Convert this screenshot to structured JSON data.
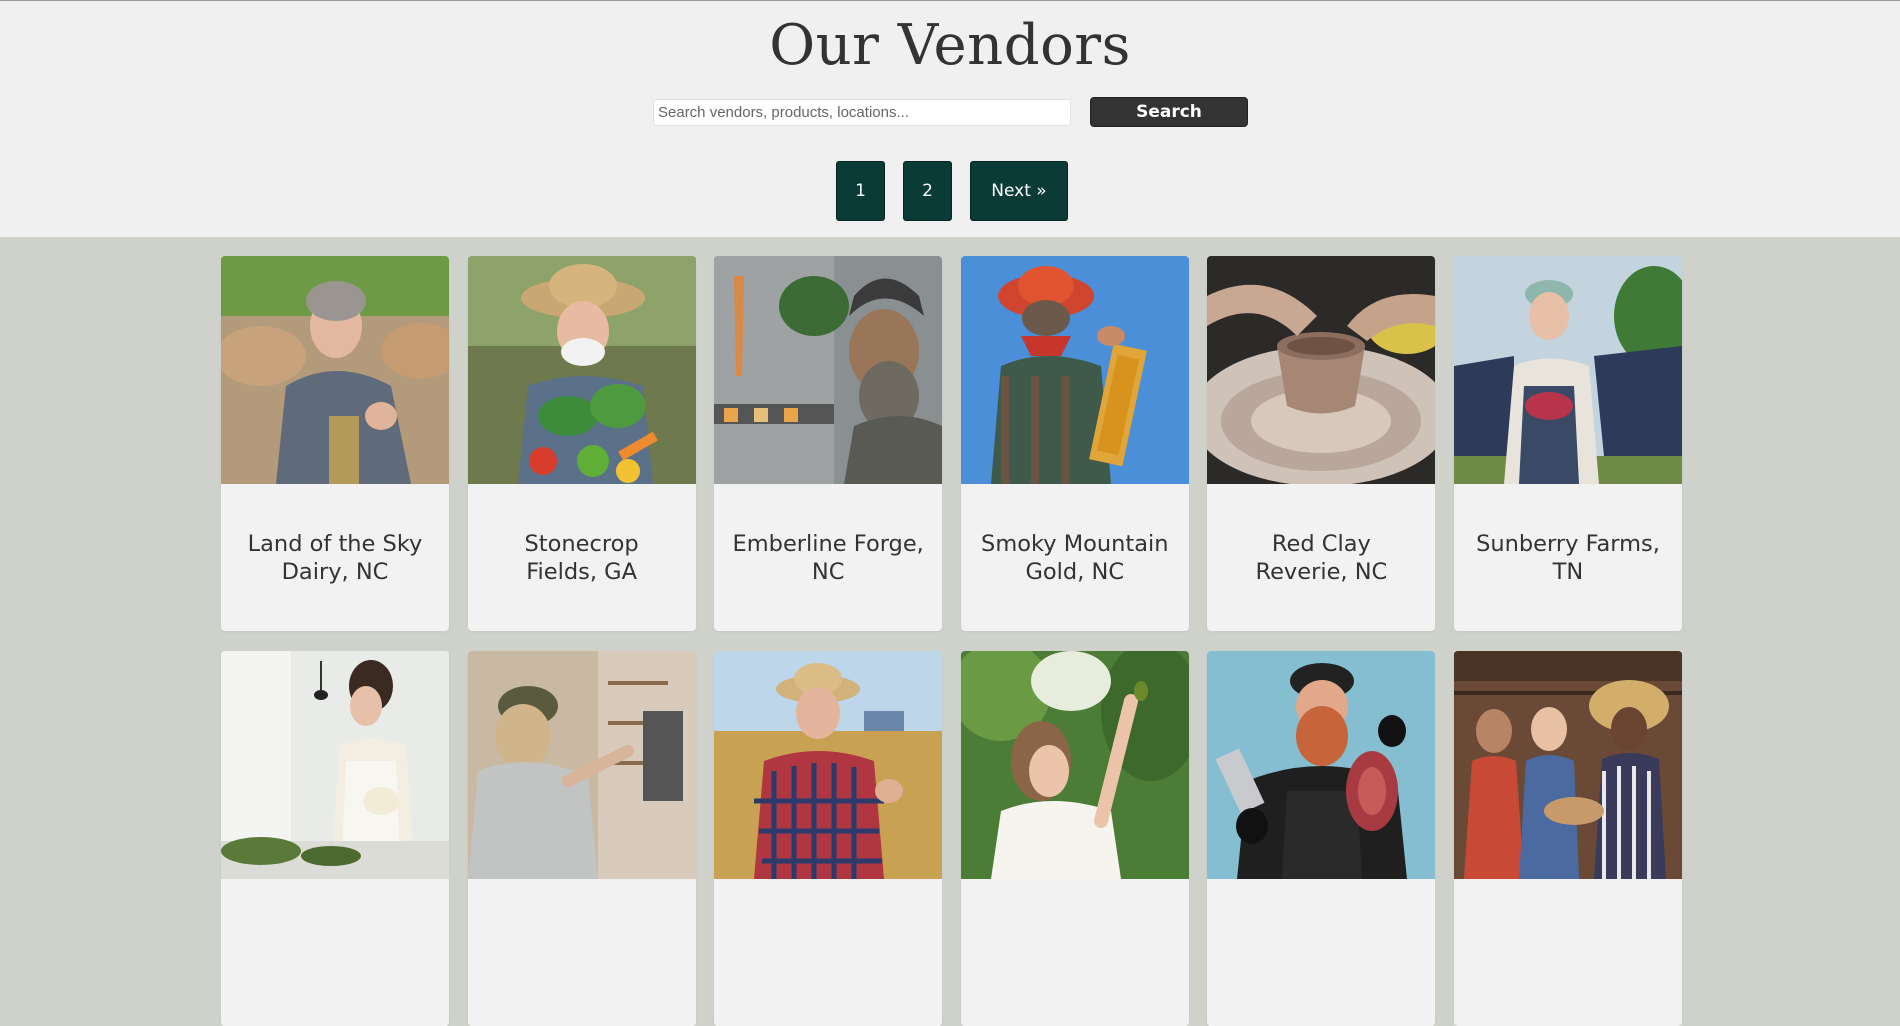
{
  "page": {
    "title": "Our Vendors"
  },
  "search": {
    "placeholder": "Search vendors, products, locations...",
    "value": "",
    "button_label": "Search"
  },
  "pagination": {
    "pages": [
      "1",
      "2"
    ],
    "next_label": "Next »"
  },
  "colors": {
    "header_bg": "#f0f0f0",
    "body_bg": "#cfd1cb",
    "pagination_bg": "#0b3b36",
    "search_button_bg": "#333333"
  },
  "vendors": [
    {
      "name": "Land of the Sky Dairy, NC",
      "photo": "dairy-farmer-photo"
    },
    {
      "name": "Stonecrop Fields, GA",
      "photo": "vegetable-farmer-photo"
    },
    {
      "name": "Emberline Forge, NC",
      "photo": "blacksmith-photo"
    },
    {
      "name": "Smoky Mountain Gold, NC",
      "photo": "beekeeper-photo"
    },
    {
      "name": "Red Clay Reverie, NC",
      "photo": "pottery-wheel-photo"
    },
    {
      "name": "Sunberry Farms, TN",
      "photo": "berry-farmer-photo"
    },
    {
      "name": "",
      "photo": "florist-photo"
    },
    {
      "name": "",
      "photo": "woodworker-photo"
    },
    {
      "name": "",
      "photo": "wheat-farmer-photo"
    },
    {
      "name": "",
      "photo": "orchard-picker-photo"
    },
    {
      "name": "",
      "photo": "butcher-photo"
    },
    {
      "name": "",
      "photo": "farm-family-photo"
    }
  ]
}
